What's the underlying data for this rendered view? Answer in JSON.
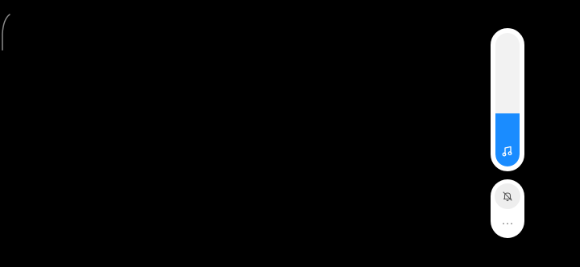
{
  "volume_panel": {
    "level_percent": 40,
    "active_stream_icon": "music-note-icon",
    "fill_color": "#1a8cff",
    "track_color": "#f2f2f2"
  },
  "ringer_panel": {
    "mode_icon": "bell-off-icon",
    "more_icon": "more-horizontal-icon"
  },
  "background_color": "#000000"
}
